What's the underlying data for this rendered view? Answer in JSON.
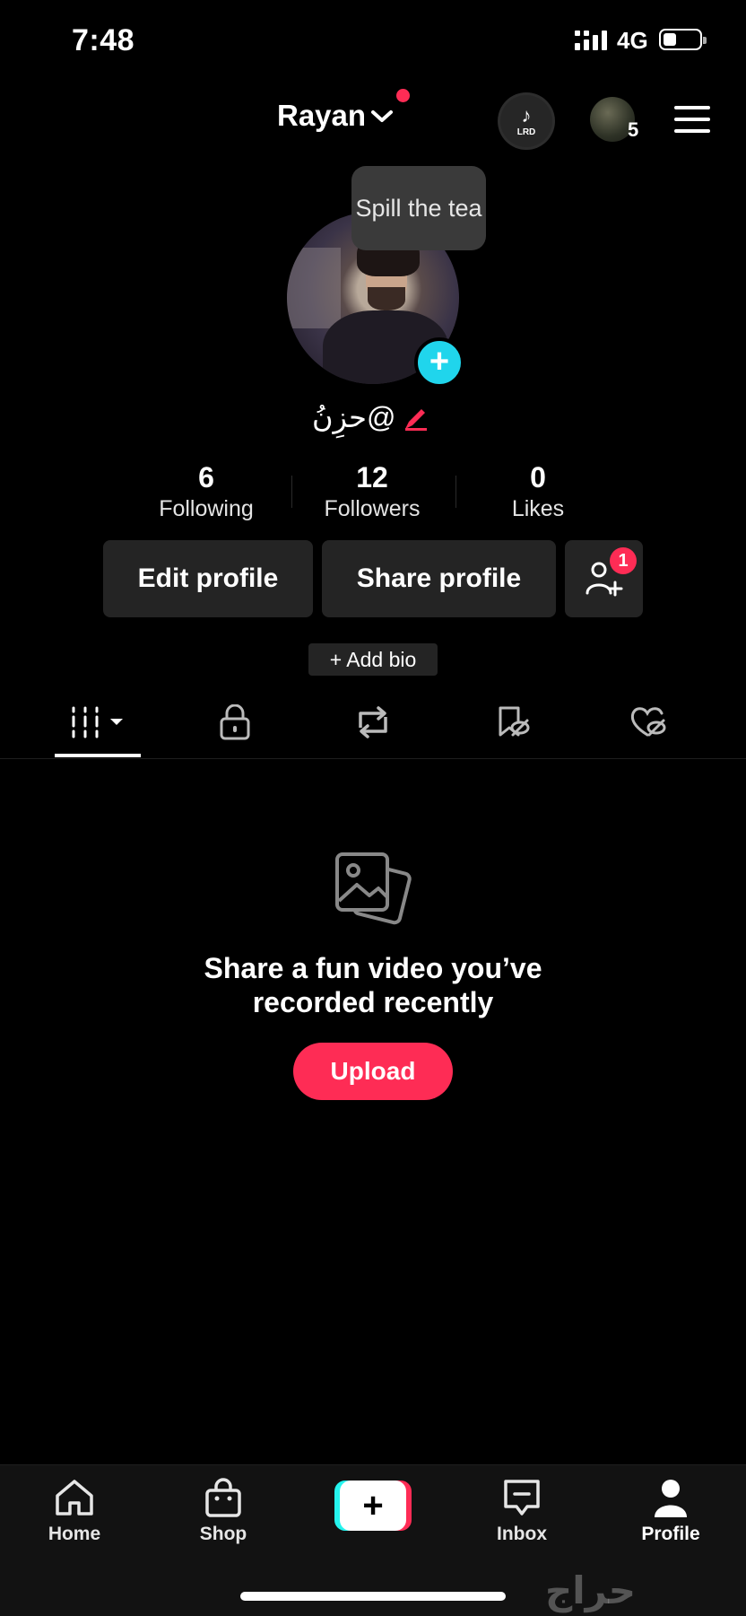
{
  "status_bar": {
    "time": "7:48",
    "network": "4G"
  },
  "header": {
    "username": "Rayan",
    "lrd_label": "LRD",
    "friends_count": "5"
  },
  "profile": {
    "tooltip": "Spill the tea",
    "handle": "@حزِنُ"
  },
  "stats": [
    {
      "value": "6",
      "label": "Following"
    },
    {
      "value": "12",
      "label": "Followers"
    },
    {
      "value": "0",
      "label": "Likes"
    }
  ],
  "actions": {
    "edit": "Edit profile",
    "share": "Share profile",
    "add_friends_badge": "1",
    "add_bio": "+ Add bio"
  },
  "tabs": [
    {
      "icon": "grid-icon",
      "active": true
    },
    {
      "icon": "lock-icon"
    },
    {
      "icon": "repost-icon"
    },
    {
      "icon": "bookmark-hidden-icon"
    },
    {
      "icon": "heart-hidden-icon"
    }
  ],
  "empty_state": {
    "line1": "Share a fun video you’ve",
    "line2": "recorded recently",
    "upload": "Upload"
  },
  "nav": {
    "home": "Home",
    "shop": "Shop",
    "inbox": "Inbox",
    "profile": "Profile"
  },
  "watermark": "حراج",
  "colors": {
    "accent": "#fe2c55",
    "cyan": "#20d5ec",
    "background": "#000000",
    "button_bg": "#242424"
  }
}
